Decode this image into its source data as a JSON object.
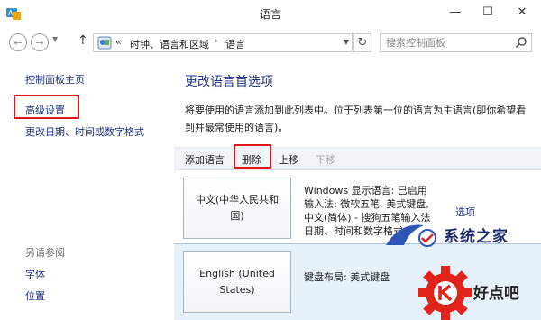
{
  "window": {
    "title": "语言",
    "min_glyph": "—",
    "max_glyph": "☐",
    "close_glyph": "✕"
  },
  "navbar": {
    "back_glyph": "←",
    "forward_glyph": "→",
    "dropdown_glyph": "▼",
    "up_glyph": "↑",
    "address_chevron": "«",
    "breadcrumb_1": "时钟、语言和区域",
    "breadcrumb_sep": "›",
    "breadcrumb_2": "语言",
    "address_dropdown_glyph": "▼",
    "refresh_glyph": "↻",
    "search_placeholder": "搜索控制面板"
  },
  "sidebar": {
    "home": "控制面板主页",
    "advanced": "高级设置",
    "datetime": "更改日期、时间或数字格式",
    "see_also": "另请参阅",
    "fonts": "字体",
    "location": "位置"
  },
  "main": {
    "title": "更改语言首选项",
    "description": "将要使用的语言添加到此列表中。位于列表第一位的语言为主语言(即你希望看到并最常使用的语言)。"
  },
  "toolbar": {
    "add": "添加语言",
    "remove": "删除",
    "move_up": "上移",
    "move_down": "下移"
  },
  "languages": [
    {
      "name": "中文(中华人民共和国)",
      "details": [
        "Windows 显示语言: 已启用",
        "输入法: 微软五笔, 美式键盘,",
        "中文(简体) - 搜狗五笔输入法",
        "日期、时间和数字格式"
      ],
      "options": "选项"
    },
    {
      "name": "English (United States)",
      "details": [
        "键盘布局: 美式键盘"
      ]
    }
  ],
  "watermarks": {
    "site_name": "系统之家",
    "site_name_2": "好点吧"
  },
  "colors": {
    "link": "#1e3287",
    "highlight_border": "#e1151c",
    "selected_row": "#e6f1fb",
    "toolbar_bg": "#f0f3f7"
  }
}
